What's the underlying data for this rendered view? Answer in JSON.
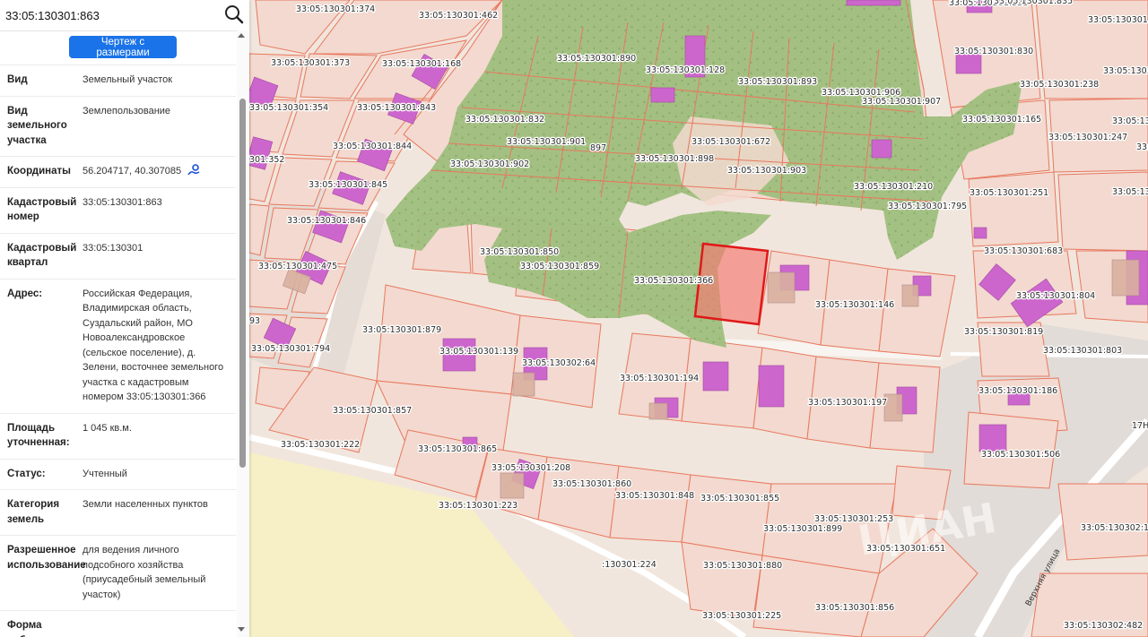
{
  "search": {
    "value": "33:05:130301:863"
  },
  "panel": {
    "drawing_button": "Чертеж с размерами",
    "rows": [
      {
        "key": "Вид",
        "value": "Земельный участок"
      },
      {
        "key": "Вид земельного участка",
        "value": "Землепользование"
      },
      {
        "key": "Координаты",
        "value": "56.204717, 40.307085"
      },
      {
        "key": "Кадастровый номер",
        "value": "33:05:130301:863"
      },
      {
        "key": "Кадастровый квартал",
        "value": "33:05:130301"
      },
      {
        "key": "Адрес:",
        "value": "Российская Федерация, Владимирская область, Суздальский район, МО Новоалександровское (сельское поселение), д. Зелени, восточнее земельного участка с кадастровым номером 33:05:130301:366"
      },
      {
        "key": "Площадь уточненная:",
        "value": "1 045 кв.м."
      },
      {
        "key": "Статус:",
        "value": "Учтенный"
      },
      {
        "key": "Категория земель",
        "value": "Земли населенных пунктов"
      },
      {
        "key": "Разрешенное использование",
        "value": "для ведения личного подсобного хозяйства (приусадебный земельный участок)"
      },
      {
        "key": "Форма собственности",
        "value": ""
      }
    ]
  },
  "map": {
    "colors": {
      "plot_fill": "#f3d9cf",
      "plot_stroke": "#e8785f",
      "forest": "#9fbf7e",
      "building": "#cc66cc",
      "selected": "#ee2a2a"
    },
    "plot_labels": [
      "33:05:130301:374",
      "33:05:130301:462",
      "33:05:130301:373",
      "33:05:130301:168",
      "33:05:130301:890",
      "33:05:130301:128",
      "33:05:130301:893",
      "33:05:130301:906",
      "33:05:130301:907",
      "33:05:130301:831",
      "33:05:130301:830",
      "33:05:130301:238",
      "33:05:130301:354",
      "33:05:130301:843",
      "33:05:130301:832",
      "33:05:130301:165",
      "33:05:130301:844",
      "33:05:130301:901",
      "33:05:130301:672",
      "33:05:130301:898",
      "33:05:130301:247",
      "301:352",
      "33:05:130301:902",
      "33:05:130301:903",
      "33:05:130301:845",
      "33:05:130301:210",
      "33:05:130301:251",
      "33:05:130301:795",
      "33:05:130301:846",
      "33:05:130301:683",
      "33:05:130301:850",
      "33:05:130301:475",
      "33:05:130301:859",
      "33:05:130301:366",
      "33:05:130301:804",
      "33:05:130301:146",
      "33:05:130301:879",
      "33:05:130301:819",
      "93",
      "33:05:130301:794",
      "33:05:130301:139",
      "33:05:130302:64",
      "33:05:130301:803",
      "33:05:130301:194",
      "33:05:130301:186",
      "33:05:130301:197",
      "33:05:130301:857",
      "33:05:130301:222",
      "33:05:130301:865",
      "33:05:130301:506",
      "33:05:130301:208",
      "33:05:130301:860",
      "33:05:130301:848",
      "33:05:130301:855",
      "33:05:130301:223",
      "33:05:130301:253",
      "33:05:130301:899",
      "33:05:130302:11",
      "33:05:130301:651",
      ":130301:224",
      "33:05:130301:880",
      "33:05:130301:856",
      "33:05:130301:225",
      "33:05:130302:482",
      "33:05:130301",
      "33:05:130",
      "33:05:130301:",
      "33:05:130",
      "33:",
      "897",
      "33:05:130301:835",
      "17Н"
    ],
    "street_label": "Верхняя улица"
  }
}
